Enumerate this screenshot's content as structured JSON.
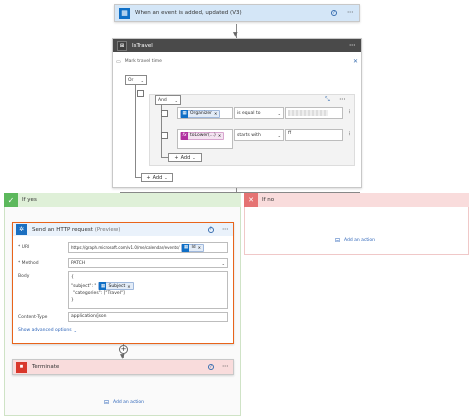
{
  "trigger": {
    "title": "When an event is added, updated (V3)",
    "icon": "outlook-calendar-icon"
  },
  "condition": {
    "title": "IsTravel",
    "note": "Mark travel time",
    "group_operator": "Or",
    "inner_operator": "And",
    "rows": [
      {
        "token": "Organizer",
        "token_color": "#0f6fc6",
        "operator": "is equal to",
        "value": ""
      },
      {
        "token": "toLower(...)",
        "token_color": "#b12fa0",
        "operator": "starts with",
        "value": "ff"
      }
    ],
    "inner_add": "Add",
    "outer_add": "Add"
  },
  "if_yes": {
    "label": "If yes",
    "http": {
      "title": "Send an HTTP request",
      "preview": "(Preview)",
      "uri_label": "* URI",
      "uri_value": "https://graph.microsoft.com/v1.0/me/calendar/events/",
      "uri_token": "Id",
      "method_label": "* Method",
      "method_value": "PATCH",
      "body_label": "Body",
      "body_open": "{",
      "body_subject_key": "\"subject\": \"",
      "body_subject_token": "Subject",
      "body_categories": "\"categories\": [\"Travel\"]",
      "body_close": "}",
      "content_type_label": "Content-Type",
      "content_type_value": "application/json",
      "advanced_link": "Show advanced options"
    },
    "terminate": {
      "title": "Terminate"
    },
    "add_action": "Add an action"
  },
  "if_no": {
    "label": "If no",
    "add_action": "Add an action"
  },
  "colors": {
    "trigger_header": "#d4e6f7",
    "condition_header": "#4a4a4a",
    "yes_header": "#dff0d8",
    "yes_check": "#5cb85c",
    "no_header": "#f9dcdc",
    "no_x": "#e57373",
    "http_border": "#e8641b",
    "terminate_header": "#f9dcdc",
    "terminate_icon": "#d9372b"
  }
}
